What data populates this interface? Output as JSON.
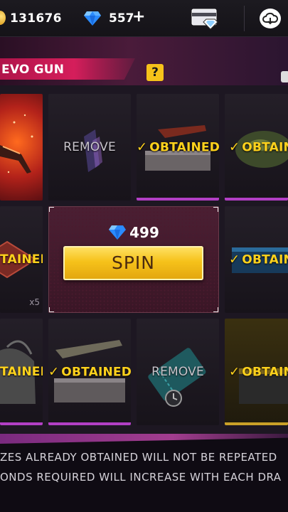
{
  "currency": {
    "coins": "131676",
    "diamonds": "557",
    "add_label": "+"
  },
  "banner": {
    "title": "EVO GUN",
    "help_label": "?"
  },
  "grid": {
    "row1": [
      {
        "kind": "weapon-art",
        "label": ""
      },
      {
        "kind": "remove",
        "label": "REMOVE"
      },
      {
        "kind": "obtained",
        "label": "OBTAINED"
      },
      {
        "kind": "obtained",
        "label": "OBTAIN"
      }
    ],
    "row2": [
      {
        "kind": "obtained",
        "label": "TAINED",
        "quantity": "x5"
      },
      {
        "kind": "spin",
        "price": "499",
        "spin_label": "SPIN"
      },
      {
        "kind": "obtained",
        "label": "OBTAIN"
      }
    ],
    "row3": [
      {
        "kind": "obtained",
        "label": "TAINED"
      },
      {
        "kind": "obtained",
        "label": "OBTAINED"
      },
      {
        "kind": "remove",
        "label": "REMOVE"
      },
      {
        "kind": "obtained",
        "label": "OBTAIN"
      }
    ]
  },
  "footer": {
    "line1": "ZES ALREADY OBTAINED WILL NOT BE REPEATED",
    "line2": "ONDS REQUIRED WILL INCREASE WITH EACH DRA"
  },
  "colors": {
    "accent_yellow": "#ffd21c",
    "spin_gold": "#f6c21a",
    "banner_red": "#d51e5b",
    "purple_glow": "#b23fc5"
  },
  "icons": [
    "coin-icon",
    "diamond-icon",
    "elite-card-icon",
    "cloud-download-icon",
    "check-icon",
    "help-icon"
  ]
}
